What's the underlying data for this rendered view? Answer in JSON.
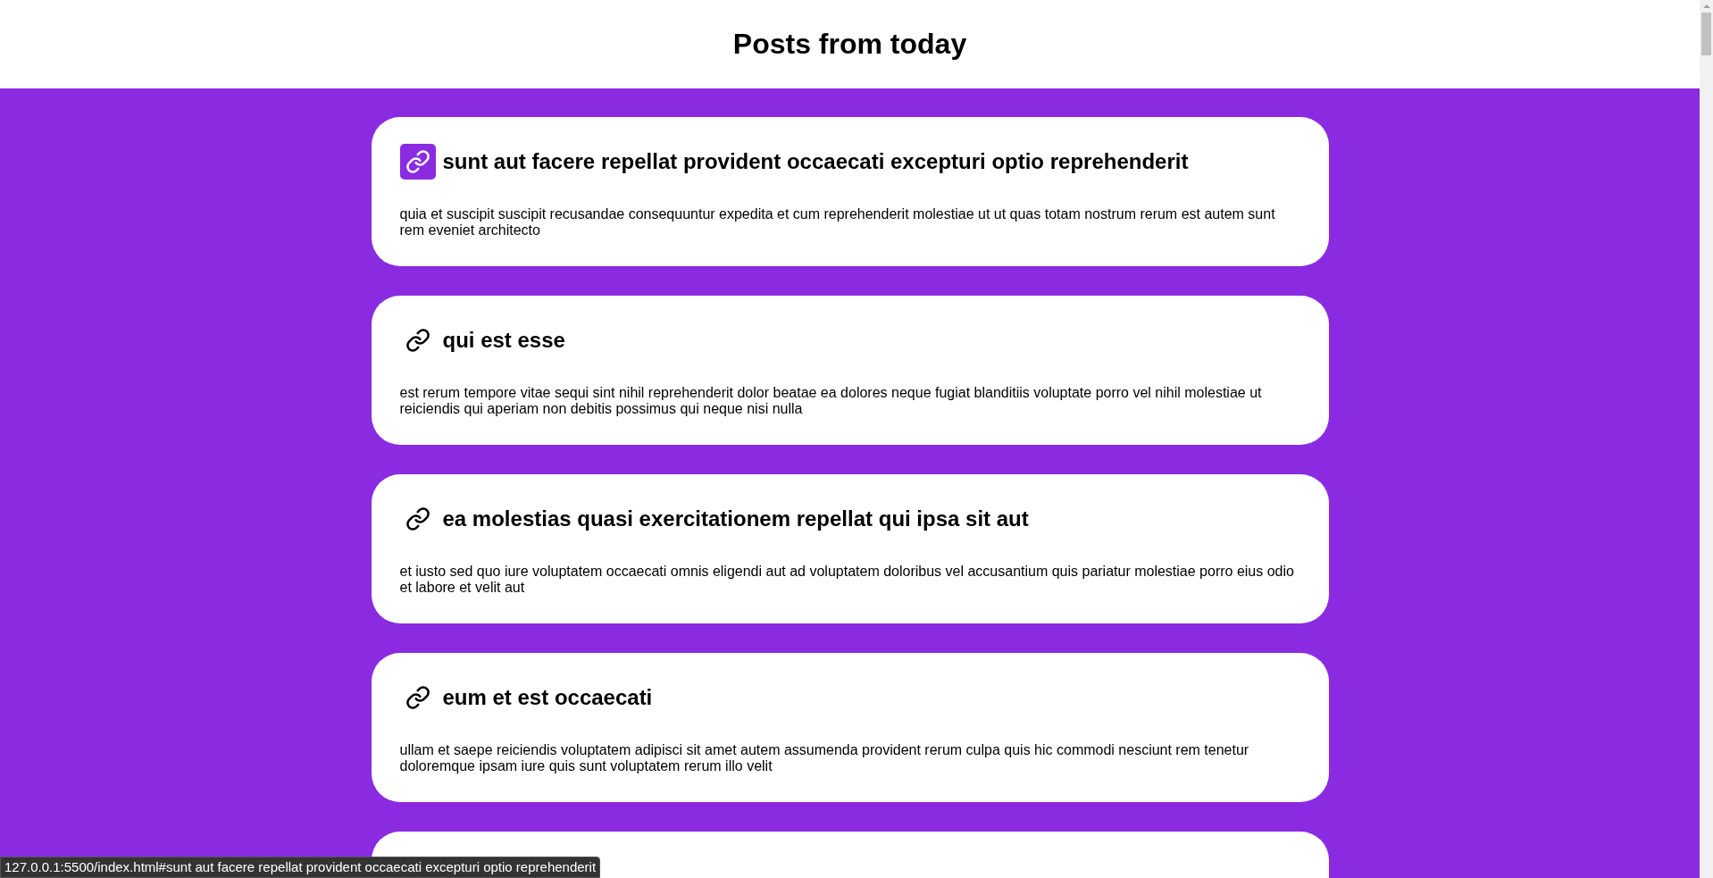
{
  "header": {
    "title": "Posts from today"
  },
  "posts": [
    {
      "title": "sunt aut facere repellat provident occaecati excepturi optio reprehenderit",
      "kind": "post",
      "body": "quia et suscipit suscipit recusandae consequuntur expedita et cum reprehenderit molestiae ut ut quas totam nostrum rerum est autem sunt rem eveniet architecto",
      "hovered": true
    },
    {
      "title": "qui est esse",
      "kind": "post",
      "body": "est rerum tempore vitae sequi sint nihil reprehenderit dolor beatae ea dolores neque fugiat blanditiis voluptate porro vel nihil molestiae ut reiciendis qui aperiam non debitis possimus qui neque nisi nulla",
      "hovered": false
    },
    {
      "title": "ea molestias quasi exercitationem repellat qui ipsa sit aut",
      "kind": "post",
      "body": "et iusto sed quo iure voluptatem occaecati omnis eligendi aut ad voluptatem doloribus vel accusantium quis pariatur molestiae porro eius odio et labore et velit aut",
      "hovered": false
    },
    {
      "title": "eum et est occaecati",
      "kind": "post",
      "body": "ullam et saepe reiciendis voluptatem adipisci sit amet autem assumenda provident rerum culpa quis hic commodi nesciunt rem tenetur doloremque ipsam iure quis sunt voluptatem rerum illo velit",
      "hovered": false
    },
    {
      "kind": "cut"
    }
  ],
  "status_bar": {
    "url": "127.0.0.1:5500/index.html#sunt aut facere repellat provident occaecati excepturi optio reprehenderit"
  }
}
